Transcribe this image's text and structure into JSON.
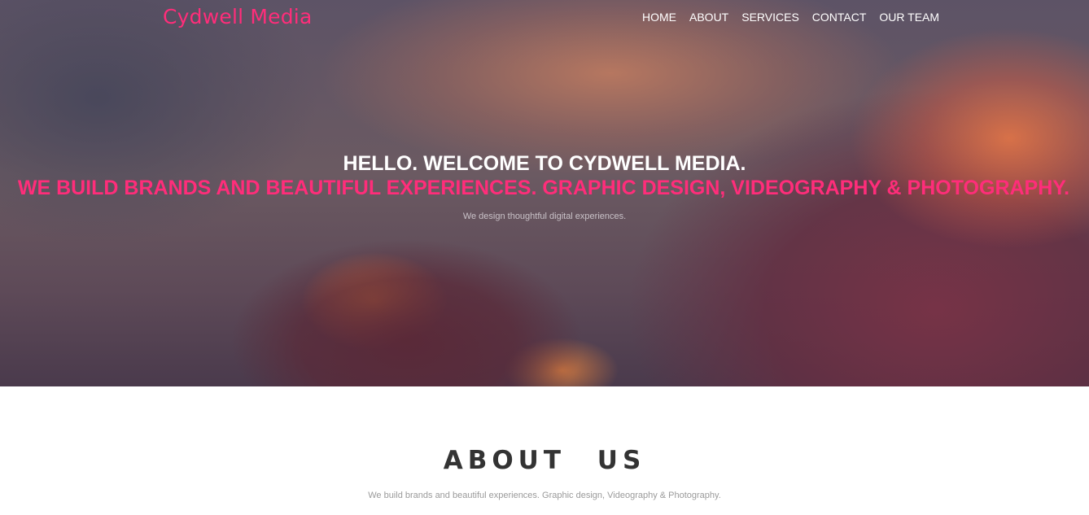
{
  "header": {
    "brand": "Cydwell Media",
    "nav": [
      "HOME",
      "ABOUT",
      "SERVICES",
      "CONTACT",
      "OUR TEAM"
    ]
  },
  "hero": {
    "line1": "HELLO. WELCOME TO CYDWELL MEDIA.",
    "line2": "WE BUILD BRANDS AND BEAUTIFUL EXPERIENCES. GRAPHIC DESIGN, VIDEOGRAPHY & PHOTOGRAPHY.",
    "subtitle": "We design thoughtful digital experiences."
  },
  "about": {
    "title": "ABOUT US",
    "text": "We build brands and beautiful experiences. Graphic design, Videography & Photography."
  },
  "colors": {
    "accent": "#ff2d7a",
    "nav_text": "#ffffff",
    "heading_dark": "#333333"
  }
}
